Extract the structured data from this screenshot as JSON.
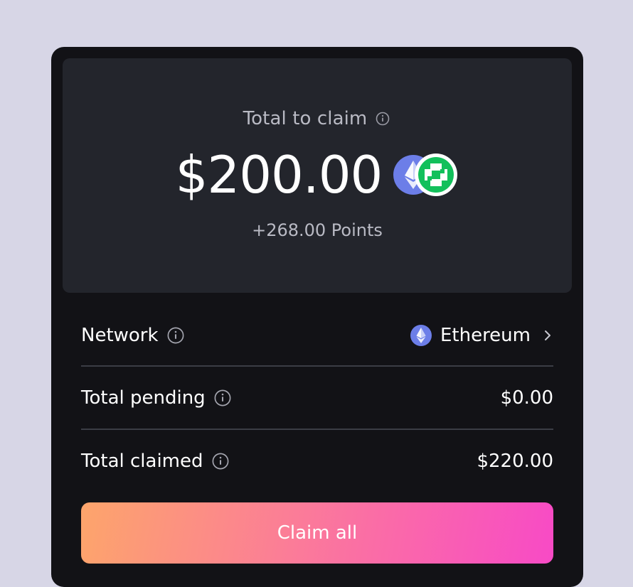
{
  "summary": {
    "label": "Total to claim",
    "amount": "$200.00",
    "points": "+268.00 Points",
    "tokens": [
      "ethereum-icon",
      "green-token-icon"
    ]
  },
  "rows": [
    {
      "label": "Network",
      "value": "Ethereum",
      "icon": "ethereum-icon",
      "has_chevron": true
    },
    {
      "label": "Total pending",
      "value": "$0.00"
    },
    {
      "label": "Total claimed",
      "value": "$220.00"
    }
  ],
  "button": {
    "label": "Claim all"
  },
  "colors": {
    "background": "#d7d6e6",
    "card": "#121216",
    "summary_panel": "#23252c",
    "divider": "#3b3d45",
    "ethereum": "#6c7ee8",
    "green_token": "#12c05b",
    "button_gradient_start": "#fda56b",
    "button_gradient_end": "#f84ac6"
  }
}
